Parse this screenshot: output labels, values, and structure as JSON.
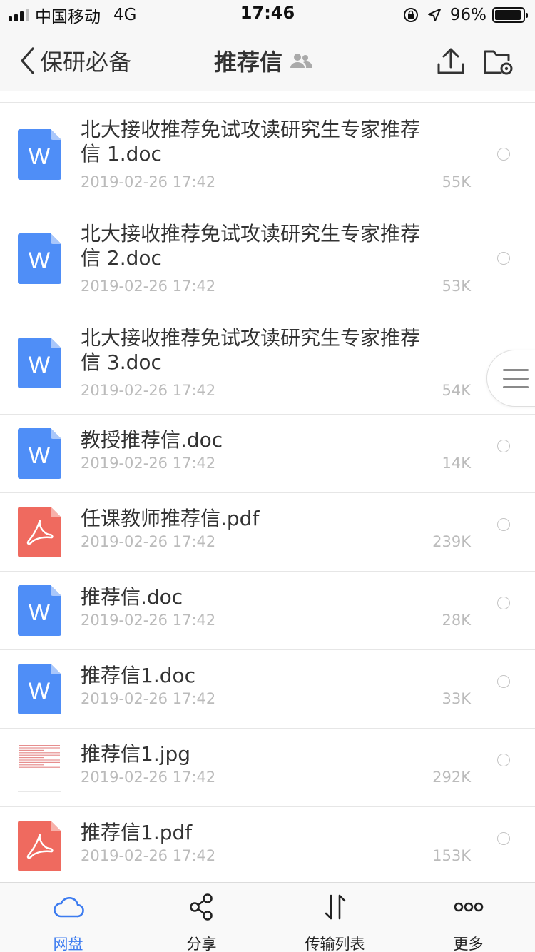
{
  "status_bar": {
    "carrier": "中国移动",
    "network": "4G",
    "time": "17:46",
    "battery_percent": "96%",
    "battery_level": 0.96
  },
  "nav": {
    "back_label": "保研必备",
    "title": "推荐信"
  },
  "files": [
    {
      "name": "北大接收推荐免试攻读研究生专家推荐信  1.doc",
      "date": "2019-02-26 17:42",
      "size": "55K",
      "type": "word"
    },
    {
      "name": "北大接收推荐免试攻读研究生专家推荐信 2.doc",
      "date": "2019-02-26 17:42",
      "size": "53K",
      "type": "word"
    },
    {
      "name": "北大接收推荐免试攻读研究生专家推荐信 3.doc",
      "date": "2019-02-26 17:42",
      "size": "54K",
      "type": "word"
    },
    {
      "name": "教授推荐信.doc",
      "date": "2019-02-26 17:42",
      "size": "14K",
      "type": "word"
    },
    {
      "name": "任课教师推荐信.pdf",
      "date": "2019-02-26 17:42",
      "size": "239K",
      "type": "pdf"
    },
    {
      "name": "推荐信.doc",
      "date": "2019-02-26 17:42",
      "size": "28K",
      "type": "word"
    },
    {
      "name": "推荐信1.doc",
      "date": "2019-02-26 17:42",
      "size": "33K",
      "type": "word"
    },
    {
      "name": "推荐信1.jpg",
      "date": "2019-02-26 17:42",
      "size": "292K",
      "type": "image"
    },
    {
      "name": "推荐信1.pdf",
      "date": "2019-02-26 17:42",
      "size": "153K",
      "type": "pdf"
    }
  ],
  "tabs": [
    {
      "label": "网盘",
      "icon": "cloud-icon",
      "active": true
    },
    {
      "label": "分享",
      "icon": "share-icon",
      "active": false
    },
    {
      "label": "传输列表",
      "icon": "transfer-icon",
      "active": false
    },
    {
      "label": "更多",
      "icon": "more-icon",
      "active": false
    }
  ],
  "colors": {
    "accent": "#3d7cf0",
    "word_icon": "#4f8ef7",
    "pdf_icon": "#ef6a5f"
  }
}
